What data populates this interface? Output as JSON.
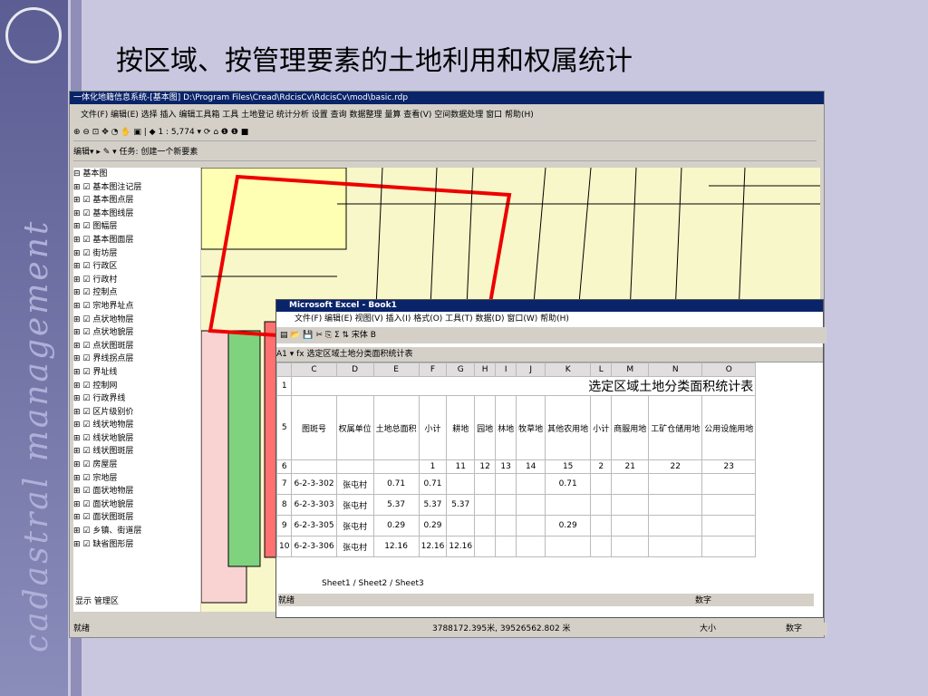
{
  "title": "按区域、按管理要素的土地利用和权属统计",
  "vertical": "cadastral management",
  "app_title": "一体化地籍信息系统-[基本图] D:\\Program Files\\Cread\\RdcisCv\\RdcisCv\\mod\\basic.rdp",
  "menu": "文件(F) 编辑(E) 选择 插入 编辑工具箱 工具 土地登记 统计分析 设置 查询 数据整理 量算 查看(V) 空间数据处理 窗口 帮助(H)",
  "scale": "1 : 5,774",
  "edit_bar": "编辑▾ ▸ ✎ ▾ 任务: 创建一个新要素",
  "layers": [
    "基本图",
    "基本图注记层",
    "基本图点层",
    "基本图线层",
    "图幅层",
    "基本图面层",
    "街坊层",
    "行政区",
    "行政村",
    "控制点",
    "宗地界址点",
    "点状地物层",
    "点状地貌层",
    "点状图斑层",
    "界线拐点层",
    "界址线",
    "控制网",
    "行政界线",
    "区片级别价",
    "线状地物层",
    "线状地貌层",
    "线状图斑层",
    "房屋层",
    "宗地层",
    "面状地物层",
    "面状地貌层",
    "面状图斑层",
    "乡镇、街道层",
    "缺省图形层"
  ],
  "tabs": [
    "显示",
    "管理区"
  ],
  "excel": {
    "title": "Microsoft Excel - Book1",
    "menu": "文件(F) 编辑(E) 视图(V) 插入(I) 格式(O) 工具(T) 数据(D) 窗口(W) 帮助(H)",
    "cell": "A1",
    "formula": "选定区域土地分类面积统计表",
    "font": "宋体",
    "cols": [
      "C",
      "D",
      "E",
      "F",
      "G",
      "H",
      "I",
      "J",
      "K",
      "L",
      "M",
      "N",
      "O"
    ],
    "heads": [
      "图斑号",
      "权属单位",
      "土地总面积",
      "小计",
      "耕地",
      "园地",
      "林地",
      "牧草地",
      "其他农用地",
      "小计",
      "商服用地",
      "工矿仓储用地",
      "公用设施用地"
    ],
    "codes": [
      "",
      "",
      "",
      "1",
      "11",
      "12",
      "13",
      "14",
      "15",
      "2",
      "21",
      "22",
      "23"
    ],
    "rows": [
      [
        "6-2-3-302",
        "张屯村",
        "0.71",
        "0.71",
        "",
        "",
        "",
        "",
        "0.71"
      ],
      [
        "6-2-3-303",
        "张屯村",
        "5.37",
        "5.37",
        "5.37"
      ],
      [
        "6-2-3-305",
        "张屯村",
        "0.29",
        "0.29",
        "",
        "",
        "",
        "",
        "0.29"
      ],
      [
        "6-2-3-306",
        "张屯村",
        "12.16",
        "12.16",
        "12.16"
      ]
    ],
    "sheets": "Sheet1 / Sheet2 / Sheet3",
    "ready": "就绪",
    "num": "数字"
  },
  "status": {
    "left": "就绪",
    "coords": "3788172.395米, 39526562.802 米",
    "size": "大小",
    "num": "数字"
  },
  "draw_font": "宋体",
  "draw_size": "10"
}
